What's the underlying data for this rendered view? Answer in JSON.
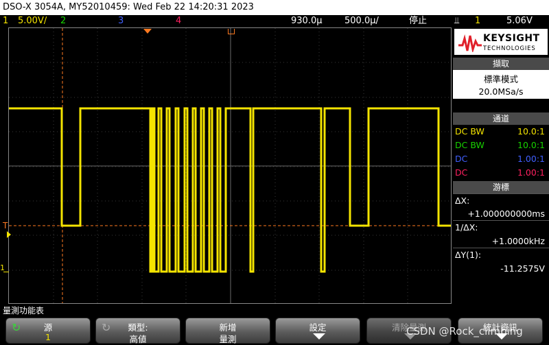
{
  "title": "DSO-X 3054A, MY52010459: Wed Feb 22 14:20:31 2023",
  "status": {
    "ch1_num": "1",
    "ch1_scale": "5.00V/",
    "ch2_num": "2",
    "ch3_num": "3",
    "ch4_num": "4",
    "time_delay": "930.0µ",
    "time_scale": "500.0µ/",
    "run_state": "停止",
    "trigger_icon": "⫫",
    "trigger_src": "1",
    "trigger_level": "5.06V"
  },
  "colors": {
    "ch1": "#f4e400",
    "ch2": "#18d200",
    "ch3": "#4060ff",
    "ch4": "#ff2060",
    "cursor": "#ff7a20"
  },
  "plot": {
    "trigger_marker": "T",
    "ground_marker": "1"
  },
  "brand": {
    "name": "KEYSIGHT",
    "sub": "TECHNOLOGIES"
  },
  "acquire": {
    "header": "擷取",
    "mode": "標準模式",
    "rate": "20.0MSa/s"
  },
  "channels": {
    "header": "通道",
    "rows": [
      {
        "coupling": "DC BW",
        "probe": "10.0:1"
      },
      {
        "coupling": "DC BW",
        "probe": "10.0:1"
      },
      {
        "coupling": "DC",
        "probe": "1.00:1"
      },
      {
        "coupling": "DC",
        "probe": "1.00:1"
      }
    ]
  },
  "cursors": {
    "header": "游標",
    "dx_label": "ΔX:",
    "dx_value": "+1.000000000ms",
    "inv_label": "1/ΔX:",
    "inv_value": "+1.0000kHz",
    "dy_label": "ΔY(1):",
    "dy_value": "-11.2575V"
  },
  "measure_menu_label": "量測功能表",
  "softkeys": [
    {
      "l1": "源",
      "l2": "1"
    },
    {
      "l1": "類型:",
      "l2": "高値"
    },
    {
      "l1": "新增",
      "l2": "量測"
    },
    {
      "l1": "設定",
      "l2": ""
    },
    {
      "l1": "清除量測",
      "l2": ""
    },
    {
      "l1": "統計資訊",
      "l2": ""
    }
  ],
  "watermark": "CSDN @Rock_climbing",
  "waveform": {
    "description_units": "ms",
    "edges_ms": [
      0.0
    ]
  }
}
